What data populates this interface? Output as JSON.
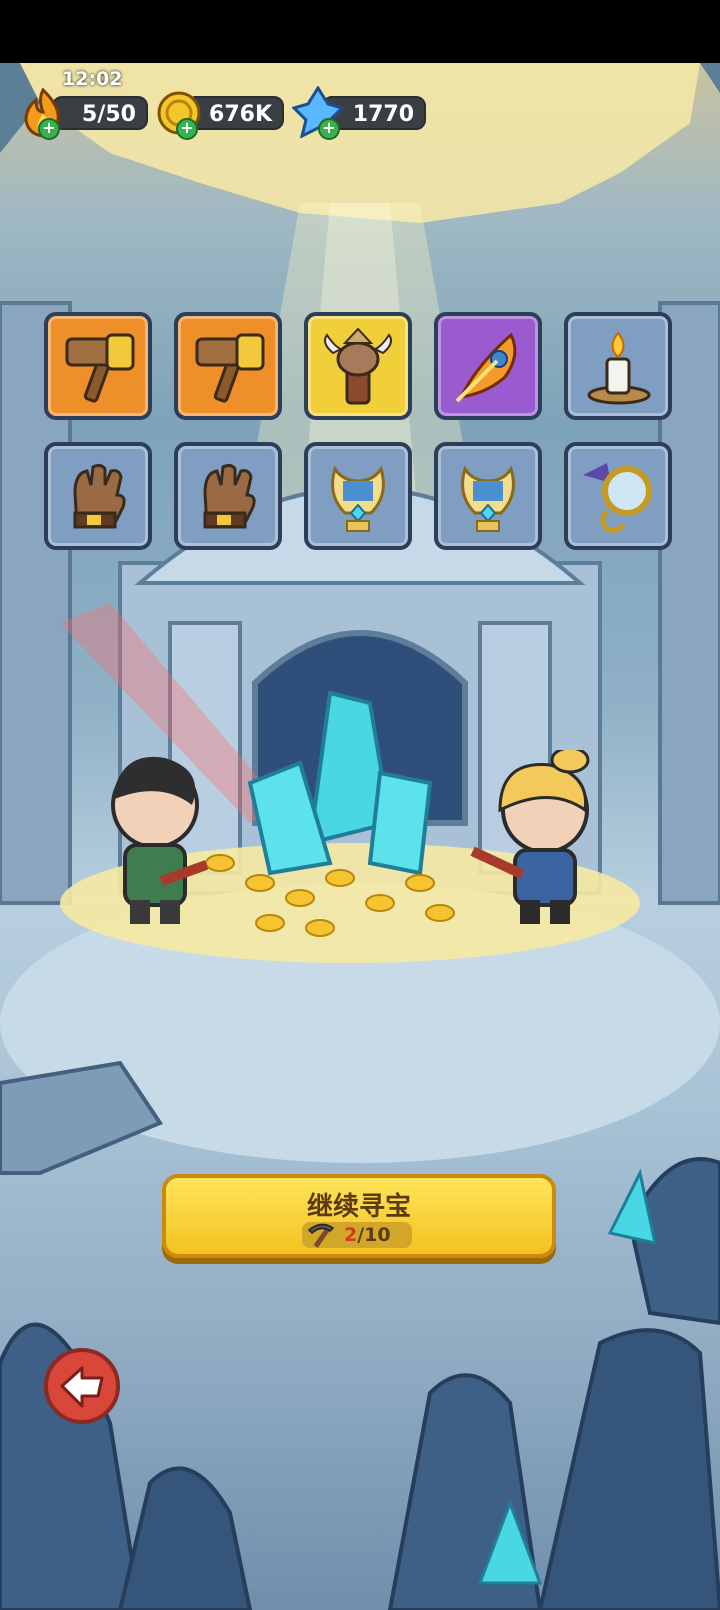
{
  "status_bar": {
    "time": "12:02"
  },
  "resources": {
    "energy": {
      "value": "5/50",
      "icon": "flame-icon"
    },
    "gold": {
      "value": "676K",
      "icon": "gold-coin-icon"
    },
    "gems": {
      "value": "1770",
      "icon": "blue-crystal-icon"
    }
  },
  "loot_grid": {
    "items": [
      {
        "name": "hammer",
        "rarity": "orange"
      },
      {
        "name": "hammer",
        "rarity": "orange"
      },
      {
        "name": "bull-totem",
        "rarity": "yellow"
      },
      {
        "name": "phoenix-feather",
        "rarity": "purple"
      },
      {
        "name": "candle",
        "rarity": "blue"
      },
      {
        "name": "leather-glove",
        "rarity": "blue"
      },
      {
        "name": "leather-glove",
        "rarity": "blue"
      },
      {
        "name": "golden-lyre",
        "rarity": "blue"
      },
      {
        "name": "golden-lyre",
        "rarity": "blue"
      },
      {
        "name": "magnifying-glass",
        "rarity": "blue"
      }
    ]
  },
  "continue_button": {
    "label": "继续寻宝",
    "pickaxe_current": "2",
    "pickaxe_total": "/10"
  },
  "colors": {
    "button_yellow": "#f3c21f",
    "rarity_orange": "#ef8f2a",
    "rarity_yellow": "#f1cf3b",
    "rarity_purple": "#9a5bd0",
    "rarity_blue": "#7f9ec2",
    "back_red": "#d9463a"
  }
}
